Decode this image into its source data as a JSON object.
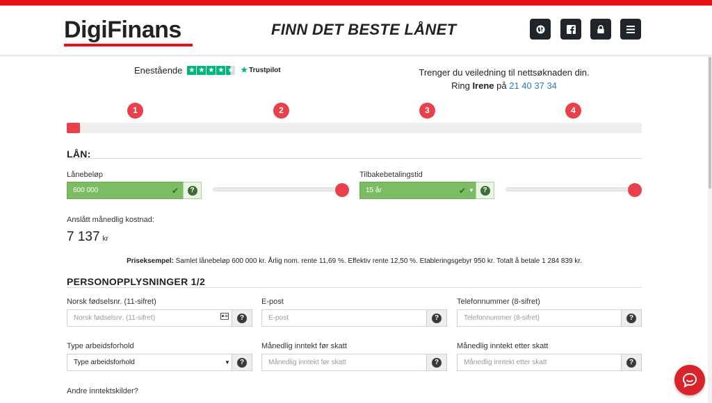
{
  "header": {
    "logo_text": "DigiFinans",
    "headline": "FINN DET BESTE LÅNET",
    "icons": [
      "globe-icon",
      "facebook-icon",
      "lock-icon",
      "menu-icon"
    ]
  },
  "trustpilot": {
    "rating_text": "Enestående",
    "brand": "Trustpilot",
    "stars": 4.5
  },
  "help": {
    "line1": "Trenger du veiledning til nettsøknaden din.",
    "ring": "Ring",
    "name": "Irene",
    "on": "på",
    "phone": "21 40 37 34"
  },
  "steps": [
    "1",
    "2",
    "3",
    "4"
  ],
  "progress": {
    "fraction": 0.02
  },
  "loan": {
    "title": "LÅN:",
    "amount_label": "Lånebeløp",
    "amount_value": "600 000",
    "amount_slider_fraction": 1.0,
    "term_label": "Tilbakebetalingstid",
    "term_value": "15 år",
    "term_slider_fraction": 1.0,
    "monthly_label": "Anslått månedlig kostnad:",
    "monthly_value": "7 137",
    "monthly_unit": "kr",
    "example_bold": "Priseksempel:",
    "example_text": "Samlet lånebeløp 600 000 kr. Årlig nom. rente 11,69 %. Effektiv rente 12,50 %. Etableringsgebyr 950 kr. Totalt å betale 1 284 839 kr."
  },
  "personal": {
    "title": "PERSONOPPLYSNINGER 1/2",
    "fields": [
      {
        "label": "Norsk fødselsnr. (11-sifret)",
        "placeholder": "Norsk fødselsnr. (11-sifret)"
      },
      {
        "label": "E-post",
        "placeholder": "E-post"
      },
      {
        "label": "Telefonnummer (8-sifret)",
        "placeholder": "Telefonnummer (8-sifret)"
      },
      {
        "label": "Type arbeidsforhold",
        "selected": "Type arbeidsforhold"
      },
      {
        "label": "Månedlig inntekt før skatt",
        "placeholder": "Månedlig inntekt før skatt"
      },
      {
        "label": "Månedlig inntekt etter skatt",
        "placeholder": "Månedlig inntekt etter skatt"
      }
    ],
    "other_income_label": "Andre inntektskilder?"
  },
  "colors": {
    "brand_red": "#e8101a",
    "accent_red": "#e8414b",
    "valid_green": "#7cbc63",
    "phone_blue": "#2b7bb9"
  }
}
